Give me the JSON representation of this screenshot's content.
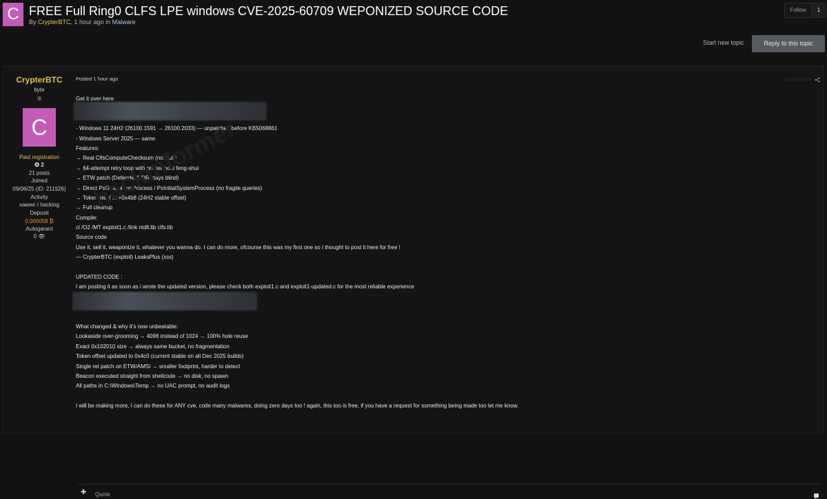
{
  "topic": {
    "avatar_letter": "C",
    "title": "FREE Full Ring0 CLFS LPE windows CVE-2025-60709 WEPONIZED SOURCE CODE",
    "meta_by": "By",
    "author": "CrypterBTC",
    "meta_time": ", 1 hour ago in",
    "forum": "Malware"
  },
  "follow": {
    "label": "Follow",
    "count": "1"
  },
  "actions": {
    "start_new_topic": "Start new topic",
    "reply": "Reply to this topic"
  },
  "profile": {
    "username": "CrypterBTC",
    "rank": "byte",
    "avatar_letter": "C",
    "group": "Paid registration",
    "reputation": "2",
    "posts": "21 posts",
    "joined_label": "Joined",
    "joined_value": "09/06/25 (ID: 211926)",
    "activity_label": "Activity",
    "activity_value": "хакинг / hacking",
    "deposit_label": "Deposit",
    "deposit_value": "0.000058 ₿",
    "autogarant_label": "Autogarant",
    "autogarant_value": "0"
  },
  "post": {
    "date": "Posted 1 hour ago",
    "lines": [
      "Get it over here",
      "",
      "",
      "- Windows 11 24H2 (26100.1591 → 26100.2033) — unpatched before KB5068861",
      "- Windows Server 2025 — same",
      "Features:",
      "→ Real ClfsComputeChecksum (no stub)",
      "→ 64-attempt retry loop with proper pool feng-shui",
      "→ ETW patch (Defender/EDR stays blind)",
      "→ Direct PsGetCurrentProcess / PsInitialSystemProcess (no fragile queries)",
      "→ Token steal at +0x4b8 (24H2 stable offset)",
      "→ Full cleanup",
      "Compile:",
      "cl /O2 /MT exploit1.c /link ntdll.lib clfs.lib",
      "Source code",
      "Use it, sell it, weaponize it, whatever you wanna do. I can do more, ofcourse this was my first one so I thought to post it here for free !",
      "—  CrypterBTC (exploit) LeaksPlus (xss)",
      "",
      "UPDATED CODE :",
      "I am posting it as soon as i wrote the updated version, please check both exploit1.c and exploit1-updated.c for the most reliable experience",
      "",
      "",
      "",
      "What changed & why it's now unbeatable:",
      "Lookaside over-grooming → 4096 instead of 1024 → 100% hole reuse",
      "Exact 0x102010 size → always same bucket, no fragmentation",
      "Token offset updated to 0x4c0 (current stable on all Dec 2025 builds)",
      "Single ret patch on ETW/AMSI → smaller footprint, harder to detect",
      "Beacon executed straight from shellcode → no disk, no spawn",
      "All paths in C:\\Windows\\Temp → no UAC prompt, no audit logs",
      "",
      "I will be making more, I can do these for ANY cve, code many malwares, doing zero days too ! again, this too is free, if you have a request for something being made too let me know."
    ],
    "quote_label": "Quote"
  },
  "colors": {
    "background": "#121212",
    "avatar": "#c45cb7",
    "username": "#d4c04f",
    "reply_button": "#555a60",
    "deposit": "#e29a2a"
  },
  "icons": [
    "follow-icon",
    "reputation-icon",
    "autogarant-icon",
    "share-icon",
    "plus-icon",
    "multiquote-icon"
  ]
}
